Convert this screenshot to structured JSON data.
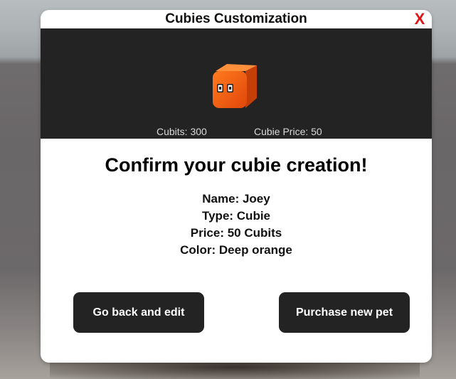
{
  "dialog": {
    "title": "Cubies Customization",
    "close_label": "X"
  },
  "preview": {
    "pet_icon": "orange-cubie-pet-icon",
    "pet_color": "#f25a0a",
    "cubits_text": "Cubits: 300",
    "price_text": "Cubie Price: 50"
  },
  "confirm": {
    "heading": "Confirm your cubie creation!",
    "name": "Name: Joey",
    "type": "Type: Cubie",
    "price": "Price: 50 Cubits",
    "color": "Color: Deep orange"
  },
  "buttons": {
    "back_label": "Go back and edit",
    "purchase_label": "Purchase new pet"
  }
}
